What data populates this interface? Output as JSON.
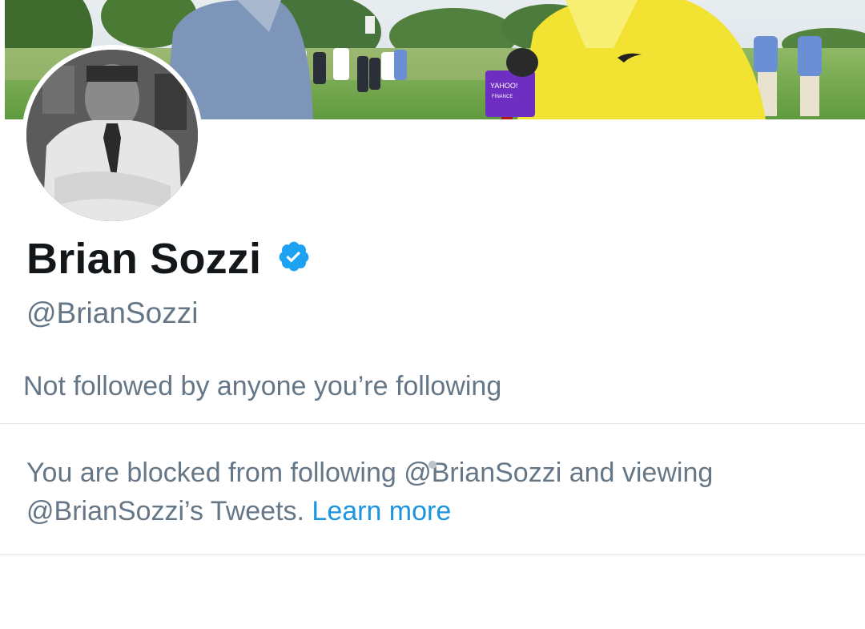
{
  "profile": {
    "display_name": "Brian Sozzi",
    "handle": "@BrianSozzi",
    "verified": true,
    "verified_icon": "verified-badge-icon"
  },
  "followers_context": {
    "text": "Not followed by anyone you’re following"
  },
  "blocked_notice": {
    "text": "You are blocked from following @BrianSozzi and viewing @BrianSozzi’s Tweets.",
    "link_label": "Learn more"
  },
  "banner": {
    "microphone_brand_text": "YAHOO!",
    "microphone_sub_text": "FINANCE"
  },
  "colors": {
    "text_primary": "#14171a",
    "text_secondary": "#657786",
    "link": "#1b95e0",
    "verified": "#1da1f2",
    "divider": "#e1e8ed"
  }
}
